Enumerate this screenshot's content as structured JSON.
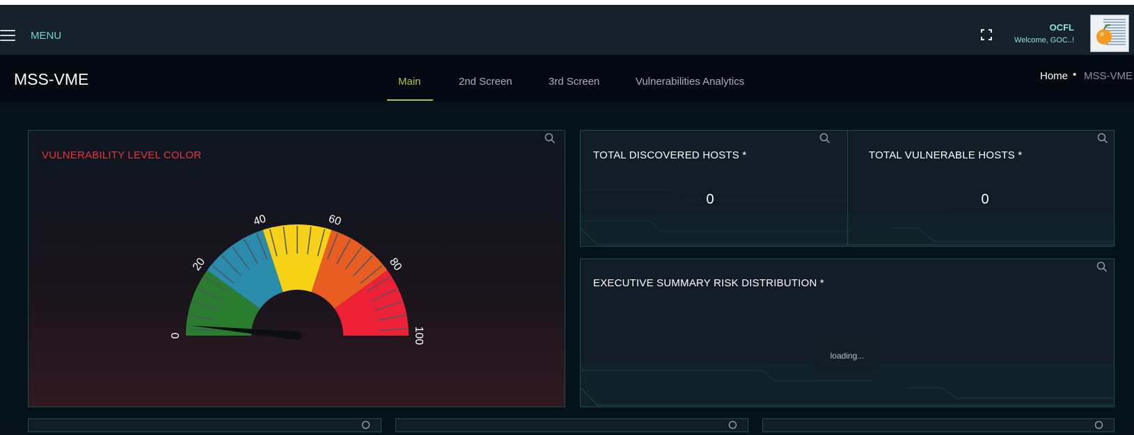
{
  "navbar": {
    "menu_label": "MENU",
    "icons": {
      "menu": "hamburger-icon",
      "fullscreen": "expand-icon",
      "search": "search-icon"
    },
    "user": {
      "name": "OCFL",
      "welcome": "Welcome, GOC..!"
    },
    "logo_text": "Orange County Government"
  },
  "header": {
    "title": "MSS-VME",
    "tabs": [
      {
        "label": "Main",
        "active": true
      },
      {
        "label": "2nd Screen",
        "active": false
      },
      {
        "label": "3rd Screen",
        "active": false
      },
      {
        "label": "Vulnerabilities Analytics",
        "active": false
      }
    ],
    "breadcrumb": {
      "home": "Home",
      "separator": "•",
      "current": "MSS-VME"
    }
  },
  "panels": {
    "gauge": {
      "title": "VULNERABILITY LEVEL COLOR",
      "title_color": "#e8333f",
      "ticks": [
        "0",
        "20",
        "40",
        "60",
        "80",
        "100"
      ],
      "needle_value": 0,
      "bands": [
        {
          "from": 0,
          "to": 20,
          "color": "#2a7d2e"
        },
        {
          "from": 20,
          "to": 40,
          "color": "#2a8bab"
        },
        {
          "from": 40,
          "to": 60,
          "color": "#f7d118"
        },
        {
          "from": 60,
          "to": 80,
          "color": "#e85d22"
        },
        {
          "from": 80,
          "to": 100,
          "color": "#ee2036"
        }
      ]
    },
    "discovered": {
      "title": "TOTAL DISCOVERED HOSTS *",
      "value": "0"
    },
    "vulnerable": {
      "title": "TOTAL VULNERABLE HOSTS *",
      "value": "0"
    },
    "executive": {
      "title": "EXECUTIVE SUMMARY RISK DISTRIBUTION *",
      "loading_text": "loading..."
    }
  }
}
